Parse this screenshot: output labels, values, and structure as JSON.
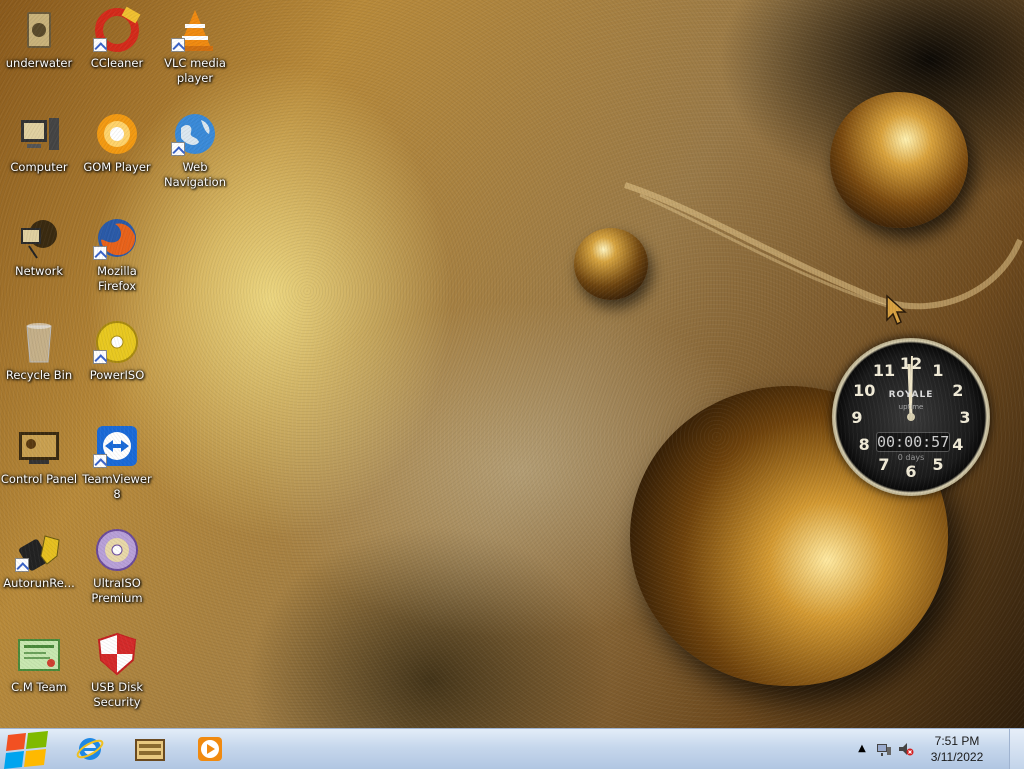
{
  "desktop_icons": [
    {
      "label": "underwater",
      "icon": "folder-icon"
    },
    {
      "label": "CCleaner",
      "icon": "ccleaner-icon"
    },
    {
      "label": "VLC media player",
      "icon": "vlc-icon"
    },
    {
      "label": "Computer",
      "icon": "computer-icon"
    },
    {
      "label": "GOM Player",
      "icon": "gom-player-icon"
    },
    {
      "label": "Web Navigation",
      "icon": "globe-icon"
    },
    {
      "label": "Network",
      "icon": "network-icon"
    },
    {
      "label": "Mozilla Firefox",
      "icon": "firefox-icon"
    },
    {
      "label": "Recycle Bin",
      "icon": "recycle-bin-icon"
    },
    {
      "label": "PowerISO",
      "icon": "poweriso-icon"
    },
    {
      "label": "Control Panel",
      "icon": "control-panel-icon"
    },
    {
      "label": "TeamViewer 8",
      "icon": "teamviewer-icon"
    },
    {
      "label": "AutorunRe...",
      "icon": "autorun-remover-icon"
    },
    {
      "label": "UltraISO Premium",
      "icon": "ultraiso-icon"
    },
    {
      "label": "C.M Team",
      "icon": "certificate-icon"
    },
    {
      "label": "USB Disk Security",
      "icon": "shield-icon"
    }
  ],
  "clock_gadget": {
    "brand": "ROYALE",
    "sub": "uptime",
    "timer": "00:00:57",
    "days": "0 days",
    "numerals": [
      "12",
      "1",
      "2",
      "3",
      "4",
      "5",
      "6",
      "7",
      "8",
      "9",
      "10",
      "11"
    ]
  },
  "taskbar": {
    "pinned": [
      "internet-explorer-icon",
      "library-icon",
      "media-player-icon"
    ],
    "tray_icons": [
      "show-hidden-icons-icon",
      "network-tray-icon",
      "volume-muted-icon"
    ],
    "time": "7:51 PM",
    "date": "3/11/2022"
  }
}
